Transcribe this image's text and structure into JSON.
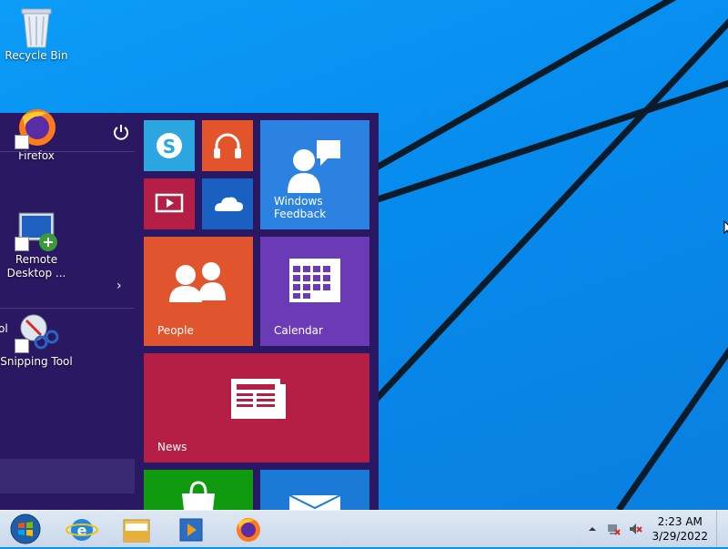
{
  "desktop": {
    "icons": [
      {
        "label": "Recycle Bin"
      },
      {
        "label": "Firefox"
      },
      {
        "label": "Remote\nDesktop ..."
      },
      {
        "label": "Snipping Tool"
      }
    ],
    "partial_label": "ol"
  },
  "start_menu": {
    "tiles": {
      "skype": {
        "icon": "skype-icon",
        "color": "#2ba6e0"
      },
      "music": {
        "icon": "headphones-icon",
        "color": "#e2552c"
      },
      "video": {
        "icon": "video-icon",
        "color": "#b51f45"
      },
      "onedrive": {
        "icon": "cloud-icon",
        "color": "#1960c1"
      },
      "windows_feedback": {
        "label": "Windows\nFeedback",
        "color": "#2b82e0"
      },
      "people": {
        "label": "People",
        "color": "#e0552e"
      },
      "calendar": {
        "label": "Calendar",
        "color": "#6a3bb5"
      },
      "news": {
        "label": "News",
        "color": "#b51f45"
      },
      "store": {
        "icon": "store-icon",
        "color": "#0f9a0f"
      },
      "mail": {
        "icon": "mail-icon",
        "color": "#1a7ad6"
      }
    }
  },
  "taskbar": {
    "buttons": [
      "start-orb",
      "internet-explorer",
      "file-explorer",
      "media-player",
      "firefox"
    ],
    "clock": {
      "time": "2:23 AM",
      "date": "3/29/2022"
    }
  }
}
